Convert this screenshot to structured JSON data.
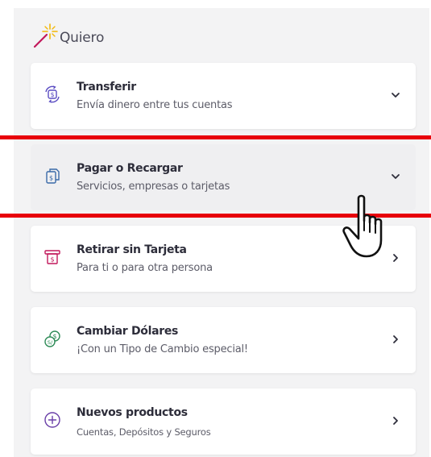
{
  "header": {
    "title": "Quiero",
    "icon": "magic-wand-icon"
  },
  "colors": {
    "accent_icon": "#5a4cc2",
    "highlight_line": "#e8000b",
    "card_bg": "#ffffff",
    "panel_bg": "#f3f3f4"
  },
  "options": [
    {
      "title": "Transferir",
      "subtitle": "Envía dinero entre tus cuentas",
      "icon": "transfer-money-icon",
      "indicator": "chevron-down-icon"
    },
    {
      "title": "Pagar o Recargar",
      "subtitle": "Servicios, empresas o tarjetas",
      "icon": "pay-bill-icon",
      "indicator": "chevron-down-icon"
    },
    {
      "title": "Retirar sin Tarjeta",
      "subtitle": "Para ti o para otra persona",
      "icon": "atm-withdraw-icon",
      "indicator": "chevron-right-icon"
    },
    {
      "title": "Cambiar Dólares",
      "subtitle": "¡Con un Tipo de Cambio especial!",
      "icon": "currency-exchange-icon",
      "indicator": "chevron-right-icon"
    },
    {
      "title": "Nuevos productos",
      "subtitle": "Cuentas, Depósitos y Seguros",
      "icon": "add-circle-icon",
      "indicator": "chevron-right-icon"
    }
  ]
}
